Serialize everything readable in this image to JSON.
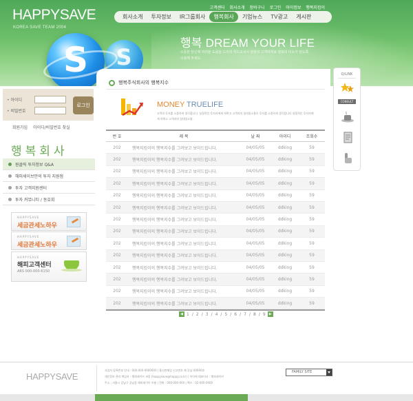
{
  "brand": {
    "logo": "HAPPYSAVE",
    "tagline_small": "KOREA SAVE TEAM 2004"
  },
  "util_links": [
    "고객센터",
    "회사소개",
    "장바구니",
    "로그인",
    "마이정보",
    "행복지킴이"
  ],
  "gnb": [
    {
      "label": "회사소개",
      "active": false
    },
    {
      "label": "투자정보",
      "active": false
    },
    {
      "label": "IR그룹회사",
      "active": false
    },
    {
      "label": "행복회사",
      "active": true
    },
    {
      "label": "기업뉴스",
      "active": false
    },
    {
      "label": "TV광고",
      "active": false
    },
    {
      "label": "게시판",
      "active": false
    }
  ],
  "hero": {
    "headline": "행복 DREAM YOUR LIFE",
    "desc": "소중한 당신께 여러분 도움을 드리려 하드모셔서 행정의 고객에게로 행복의 미소가 담도록 이용해 주세요."
  },
  "login": {
    "id_label": "아이디",
    "pw_label": "비밀번호",
    "button": "로그인",
    "join": "회원가입",
    "find": "아이디/비밀번호 찾실"
  },
  "section_title": "행복회사",
  "sub_menu": [
    {
      "label": "원클릭 투자정보 Q&A",
      "active": true
    },
    {
      "label": "해피세이브만의 투자 지원점",
      "active": false
    },
    {
      "label": "투자 고객지원센터",
      "active": false
    },
    {
      "label": "투자 커뮤니티 / 동호회",
      "active": false
    }
  ],
  "banners": [
    {
      "small": "HAPPYSAVE",
      "big": "세금관세노하우"
    },
    {
      "small": "HAPPYSAVE",
      "big": "세금관세노하우"
    }
  ],
  "service_banner": {
    "small": "HAPPYSAVE",
    "big": "해피고객센터",
    "phone": "ARS 000-000-6150"
  },
  "main": {
    "title": "행복주식회사의 행복지수",
    "money_title_a": "MONEY",
    "money_title_b": "TRUELIFE",
    "money_desc": "고객의 투자를 소중하게 생각합니다. 실질적인 투자자에게 하며고 고객과의 일대일소통이 투자를 소중하게 생각합니다 실질적인 투자자에게 하며고 고객과의 일대일소통."
  },
  "board": {
    "headers": {
      "no": "번 호",
      "title": "제 목",
      "date": "날 짜",
      "author": "아이디",
      "views": "조회수"
    },
    "rows": [
      {
        "no": "202",
        "title": "행복지킴이의 행복지수를 그려보고 보이드립니다.",
        "date": "04/05/05",
        "author": "ddking",
        "views": "59"
      },
      {
        "no": "202",
        "title": "행복지킴이의 행복지수를 그려보고 보이드립니다.",
        "date": "04/05/05",
        "author": "ddking",
        "views": "59"
      },
      {
        "no": "202",
        "title": "행복지킴이의 행복지수를 그려보고 보이드립니다.",
        "date": "04/05/05",
        "author": "ddking",
        "views": "59"
      },
      {
        "no": "202",
        "title": "행복지킴이의 행복지수를 그려보고 보이드립니다.",
        "date": "04/05/05",
        "author": "ddking",
        "views": "59"
      },
      {
        "no": "202",
        "title": "행복지킴이의 행복지수를 그려보고 보이드립니다.",
        "date": "04/05/05",
        "author": "ddking",
        "views": "59"
      },
      {
        "no": "202",
        "title": "행복지킴이의 행복지수를 그려보고 보이드립니다.",
        "date": "04/05/05",
        "author": "ddking",
        "views": "59"
      },
      {
        "no": "202",
        "title": "행복지킴이의 행복지수를 그려보고 보이드립니다.",
        "date": "04/05/05",
        "author": "ddking",
        "views": "59"
      },
      {
        "no": "202",
        "title": "행복지킴이의 행복지수를 그려보고 보이드립니다.",
        "date": "04/05/05",
        "author": "ddking",
        "views": "59"
      },
      {
        "no": "202",
        "title": "행복지킴이의 행복지수를 그려보고 보이드립니다.",
        "date": "04/05/05",
        "author": "ddking",
        "views": "59"
      },
      {
        "no": "202",
        "title": "행복지킴이의 행복지수를 그려보고 보이드립니다.",
        "date": "04/05/05",
        "author": "ddking",
        "views": "59"
      },
      {
        "no": "202",
        "title": "행복지킴이의 행복지수를 그려보고 보이드립니다.",
        "date": "04/05/05",
        "author": "ddking",
        "views": "59"
      },
      {
        "no": "202",
        "title": "행복지킴이의 행복지수를 그려보고 보이드립니다.",
        "date": "04/05/05",
        "author": "ddking",
        "views": "59"
      },
      {
        "no": "202",
        "title": "행복지킴이의 행복지수를 그려보고 보이드립니다.",
        "date": "04/05/05",
        "author": "ddking",
        "views": "59"
      },
      {
        "no": "202",
        "title": "행복지킴이의 행복지수를 그려보고 보이드립니다.",
        "date": "04/05/05",
        "author": "ddking",
        "views": "59"
      }
    ]
  },
  "pagination": {
    "pages": [
      "1",
      "2",
      "3",
      "4",
      "5",
      "6",
      "7",
      "8",
      "9"
    ],
    "prev": "◀",
    "next": "▶"
  },
  "quick": {
    "title": "Q/LINK",
    "consult": "CONSULT"
  },
  "footer": {
    "logo": "HAPPYSAVE",
    "info_1": "사업자 등록번호 안내 : 000-000-0000000 | 통신판매업 신고번호 제 강남-00000호",
    "info_2": "개인정보 관리 책임자 : 해피세이브 과장 (happysave@happy.co.kr) | 이이에 대표이사 : 해피세이브",
    "info_3": "주소 : 서울시 강남구 강남동 해피세이브 이층 | 전화 : 000-000-000 | 팩스 : 02-000-0000",
    "family_site": "FAMILY SITE"
  },
  "colors": {
    "brand_green": "#6aaa55",
    "accent_orange": "#e3872e"
  }
}
